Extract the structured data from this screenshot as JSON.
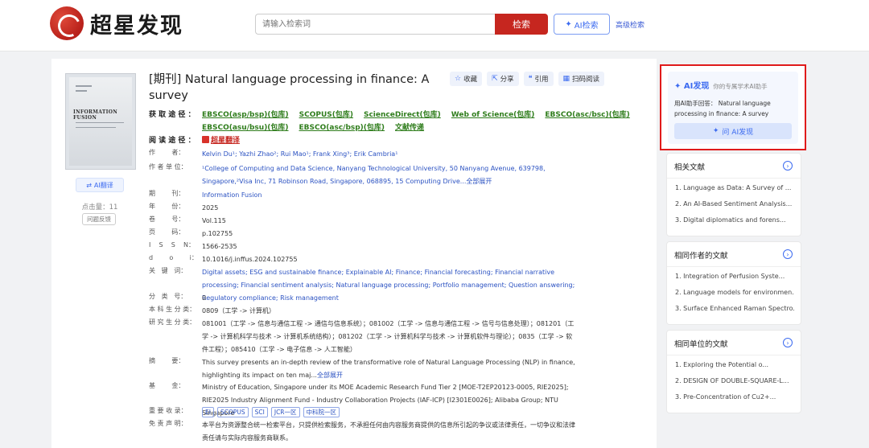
{
  "header": {
    "logo_text": "超星发现",
    "search_placeholder": "请输入检索词",
    "search_button": "检索",
    "ai_search_button": "AI检索",
    "advanced_search": "高级检索"
  },
  "cover": {
    "journal_name": "INFORMATION FUSION"
  },
  "left": {
    "ai_translate": "AI翻译",
    "click_count": "点击量：11",
    "feedback": "问题反馈"
  },
  "article": {
    "title": "[期刊] Natural language processing in finance: A survey",
    "actions": {
      "favorite": "收藏",
      "share": "分享",
      "cite": "引用",
      "scan_read": "扫码阅读"
    },
    "access_label": "获 取 途 径 ：",
    "access_links": [
      "EBSCO(asp/bsp)(包库)",
      "SCOPUS(包库)",
      "ScienceDirect(包库)",
      "Web of Science(包库)",
      "EBSCO(asc/bsc)(包库)",
      "EBSCO(asu/bsu)(包库)",
      "EBSCO(asc/bsp)(包库)",
      "文献传递"
    ],
    "read_label": "阅 读 途 径 ：",
    "read_link": "超星翻译",
    "authors_label": "作        者：",
    "authors": "Kelvin Du¹; Yazhi Zhao²; Rui Mao¹; Frank Xing³; Erik Cambria¹",
    "affiliation_label": "作 者 单 位：",
    "affiliation": "¹College of Computing and Data Science, Nanyang Technological University, 50 Nanyang Avenue, 639798, Singapore,²Visa Inc, 71 Robinson Road, Singapore, 068895, 15 Computing Drive...",
    "expand_all": "全部展开",
    "journal_label": "期        刊：",
    "journal": "Information Fusion",
    "year_label": "年        份：",
    "year": "2025",
    "volume_label": "卷        号：",
    "volume": "Vol.115",
    "page_label": "页        码：",
    "page": "p.102755",
    "issn_label": "I    S    S    N：",
    "issn": "1566-2535",
    "doi_label": "d        o        i：",
    "doi": "10.1016/j.inffus.2024.102755",
    "keywords_label": "关   键   词：",
    "keywords": "Digital assets; ESG and sustainable finance; Explainable AI; Finance; Financial forecasting; Financial narrative processing; Financial sentiment analysis; Natural language processing; Portfolio management; Question answering; Regulatory compliance; Risk management",
    "class_label": "分   类   号：",
    "class_no": "0",
    "undergrad_label": "本 科 生 分 类：",
    "undergrad": "0809（工学 -> 计算机）",
    "grad_label": "研 究 生 分 类：",
    "grad": "081001（工学 -> 信息与通信工程 -> 通信与信息系统）；081002（工学 -> 信息与通信工程 -> 信号与信息处理）；081201（工学 -> 计算机科学与技术 -> 计算机系统结构）；081202（工学 -> 计算机科学与技术 -> 计算机软件与理论）；0835（工学 -> 软件工程）；085410（工学 -> 电子信息 -> 人工智能）",
    "abstract_label": "摘        要：",
    "abstract": "This survey presents an in-depth review of the transformative role of Natural Language Processing (NLP) in finance, highlighting its impact on ten maj...",
    "fund_label": "基        金：",
    "fund": "Ministry of Education, Singapore under its MOE Academic Research Fund Tier 2 [MOE-T2EP20123-0005, RIE2025]; RIE2025 Industry Alignment Fund - Industry Collaboration Projects (IAF-ICP) [I2301E0026]; Alibaba Group; NTU Singapore",
    "index_label": "重 要 收 录：",
    "indexes": [
      "EI",
      "SCOPUS",
      "SCI",
      "JCR一区",
      "中科院一区"
    ],
    "disclaimer_label": "免 责 声 明：",
    "disclaimer": "本平台为资源整合统一检索平台，只提供检索服务，不承担任何由内容服务商提供的信息所引起的争议或法律责任，一切争议和法律责任请与实际内容服务商联系。"
  },
  "ai_card": {
    "brand": "AI发现",
    "subtitle": "你的专属学术AI助手",
    "prompt": "用AI助手回答： Natural language processing in finance: A survey",
    "button": "问 AI发现"
  },
  "related": {
    "title": "相关文献",
    "items": [
      "1. Language as Data: A Survey of ...",
      "2. An AI-Based Sentiment Analysis...",
      "3. Digital diplomatics and forens..."
    ]
  },
  "same_author": {
    "title": "相同作者的文献",
    "items": [
      "1. Integration of Perfusion Syste...",
      "2. Language models for environmen...",
      "3. Surface Enhanced Raman Spectro..."
    ]
  },
  "same_unit": {
    "title": "相同单位的文献",
    "items": [
      "1. Exploring the Potential o...",
      "2. DESIGN OF DOUBLE-SQUARE-L...",
      "3. Pre-Concentration of Cu2+..."
    ]
  },
  "colors": {
    "brand_red": "#c6261f",
    "ai_blue": "#3c6bf0",
    "link_green": "#2f7d1c",
    "highlight_red": "#e01a1a"
  }
}
